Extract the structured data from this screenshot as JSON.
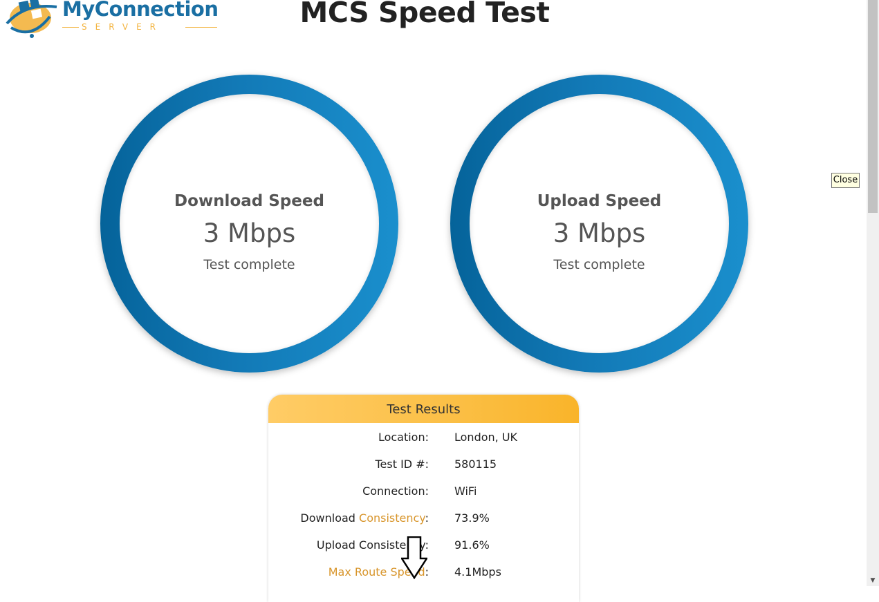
{
  "logo": {
    "main": "MyConnection",
    "sub": "SERVER"
  },
  "title": "MCS Speed Test",
  "download": {
    "label": "Download Speed",
    "value": "3 Mbps",
    "status": "Test complete"
  },
  "upload": {
    "label": "Upload Speed",
    "value": "3 Mbps",
    "status": "Test complete"
  },
  "close_tip": "Close",
  "results": {
    "header": "Test Results",
    "location": {
      "key": "Location:",
      "value": "London, UK"
    },
    "test_id": {
      "key": "Test ID #:",
      "value": "580115"
    },
    "connection": {
      "key": "Connection:",
      "value": "WiFi"
    },
    "download_consistency": {
      "key_pre": "Download ",
      "key_link": "Consistency",
      "key_post": ":",
      "value": "73.9%"
    },
    "upload_consistency": {
      "key": "Upload Consistency:",
      "value": "91.6%"
    },
    "max_route": {
      "key_link": "Max Route Speed",
      "key_post": ":",
      "value": "4.1Mbps"
    }
  },
  "colors": {
    "brand_blue": "#1a6fa3",
    "brand_gold": "#f3b33d",
    "gauge_dark": "#05639a",
    "gauge_light": "#1a8fcd",
    "link": "#d8952b"
  }
}
